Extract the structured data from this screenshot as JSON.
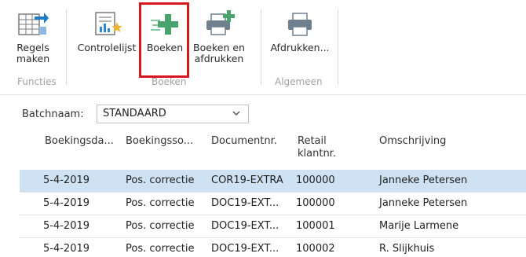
{
  "ribbon": {
    "buttons": [
      {
        "label_lines": [
          "Regels",
          "maken"
        ],
        "icon": "table-arrow-icon"
      },
      {
        "label_lines": [
          "Controlelijst"
        ],
        "icon": "checklist-report-icon"
      },
      {
        "label_lines": [
          "Boeken"
        ],
        "icon": "post-plus-icon"
      },
      {
        "label_lines": [
          "Boeken en",
          "afdrukken"
        ],
        "icon": "post-print-icon"
      },
      {
        "label_lines": [
          "Afdrukken..."
        ],
        "icon": "printer-icon"
      }
    ],
    "groups": [
      "Functies",
      "Boeken",
      "Algemeen"
    ],
    "highlight_color": "#d8161d"
  },
  "batch": {
    "label": "Batchnaam:",
    "value": "STANDAARD"
  },
  "table": {
    "columns": [
      [
        "Boekingsda..."
      ],
      [
        "Boekingsso..."
      ],
      [
        "Documentnr."
      ],
      [
        "Retail",
        "klantnr."
      ],
      [
        "Omschrijving"
      ]
    ],
    "rows": [
      {
        "date": "5-4-2019",
        "type": "Pos. correctie",
        "doc": "COR19-EXTRA",
        "cust": "100000",
        "desc": "Janneke Petersen",
        "selected": true
      },
      {
        "date": "5-4-2019",
        "type": "Pos. correctie",
        "doc": "DOC19-EXT...",
        "cust": "100000",
        "desc": "Janneke Petersen",
        "selected": false
      },
      {
        "date": "5-4-2019",
        "type": "Pos. correctie",
        "doc": "DOC19-EXT...",
        "cust": "100001",
        "desc": "Marije Larmene",
        "selected": false
      },
      {
        "date": "5-4-2019",
        "type": "Pos. correctie",
        "doc": "DOC19-EXT...",
        "cust": "100002",
        "desc": "R. Slijkhuis",
        "selected": false
      }
    ],
    "selected_color": "#cfe2f3"
  }
}
